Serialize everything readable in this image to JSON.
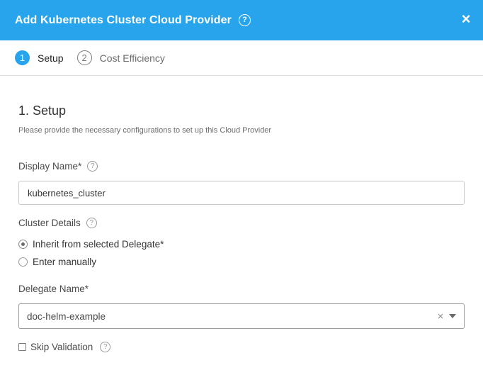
{
  "header": {
    "title": "Add Kubernetes Cluster Cloud Provider",
    "help_glyph": "?",
    "close_glyph": "×"
  },
  "steps": [
    {
      "number": "1",
      "label": "Setup",
      "active": true
    },
    {
      "number": "2",
      "label": "Cost Efficiency",
      "active": false
    }
  ],
  "section": {
    "title": "1. Setup",
    "description": "Please provide the necessary configurations to set up this Cloud Provider"
  },
  "display_name": {
    "label": "Display Name*",
    "value": "kubernetes_cluster",
    "help_glyph": "?"
  },
  "cluster_details": {
    "label": "Cluster Details",
    "help_glyph": "?",
    "options": [
      {
        "label": "Inherit from selected Delegate*",
        "selected": true
      },
      {
        "label": "Enter manually",
        "selected": false
      }
    ]
  },
  "delegate": {
    "label": "Delegate Name*",
    "value": "doc-helm-example",
    "clear_glyph": "×"
  },
  "skip_validation": {
    "label": "Skip Validation",
    "checked": false,
    "help_glyph": "?"
  },
  "colors": {
    "header_bg": "#27a4ec",
    "active_step": "#27a4ec"
  },
  "icons": [
    "help-icon",
    "close-icon",
    "clear-icon",
    "chevron-down-icon"
  ]
}
